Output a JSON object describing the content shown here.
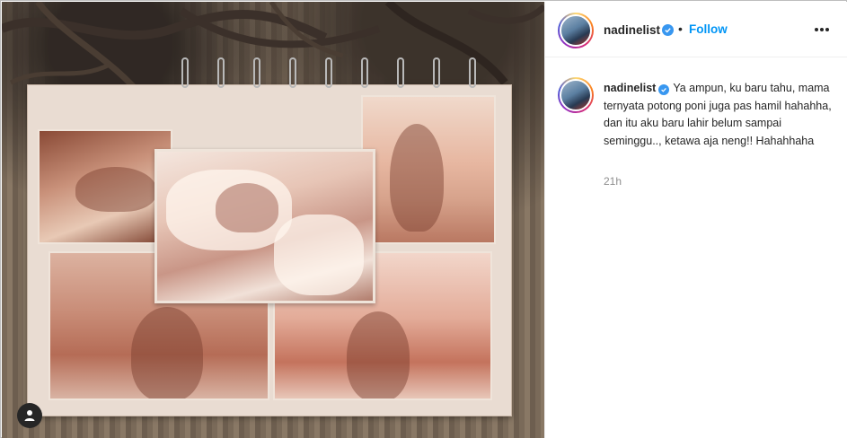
{
  "post": {
    "username": "nadinelist",
    "verified": true,
    "separator": "•",
    "follow_label": "Follow",
    "more_icon": "more-horizontal-icon",
    "caption_text": "Ya ampun, ku baru tahu, mama ternyata potong poni juga pas hamil hahahha, dan itu aku baru lahir belum sampai seminggu.., ketawa aja neng!! Hahahhaha",
    "timestamp": "21h"
  },
  "media": {
    "user_tag_icon": "user-icon"
  },
  "colors": {
    "accent": "#0095f6",
    "verified_badge": "#3897f0",
    "text": "#262626",
    "muted": "#8e8e8e"
  }
}
